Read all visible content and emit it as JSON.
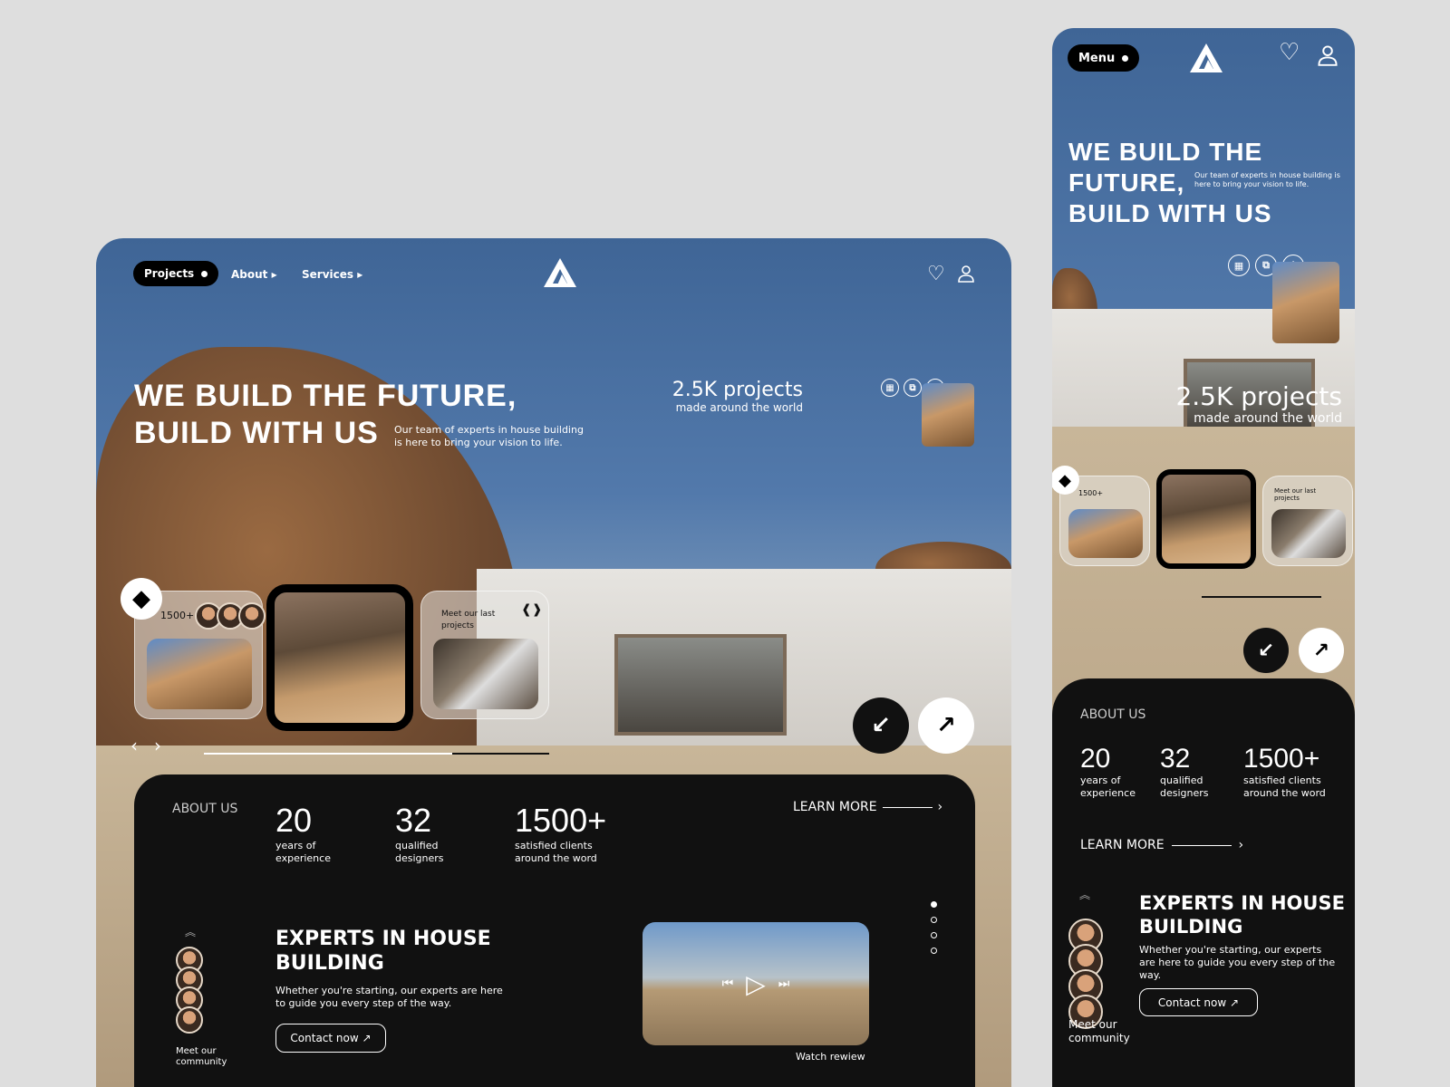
{
  "desktop": {
    "nav": {
      "projects": "Projects",
      "about": "About ▸",
      "services": "Services ▸"
    },
    "hero": {
      "line1": "WE BUILD THE FUTURE,",
      "line2": "BUILD WITH US",
      "desc1": "Our team of experts in house building",
      "desc2": "is here to bring your vision to life."
    },
    "stat": {
      "value": "2.5K projects",
      "label": "made around the world"
    },
    "cards": {
      "count": "1500+",
      "meet1": "Meet our last",
      "meet2": "projects"
    },
    "about": {
      "title": "ABOUT US",
      "learn": "LEARN MORE",
      "stats": [
        {
          "v": "20",
          "l1": "years of",
          "l2": "experience"
        },
        {
          "v": "32",
          "l1": "qualified",
          "l2": "designers"
        },
        {
          "v": "1500+",
          "l1": "satisfied clients",
          "l2": "around the word"
        }
      ]
    },
    "experts": {
      "t1": "EXPERTS IN HOUSE",
      "t2": "BUILDING",
      "d1": "Whether you're starting, our experts are here",
      "d2": "to guide you every step of the way.",
      "contact": "Contact now ↗",
      "watch": "Watch rewiew",
      "community1": "Meet our",
      "community2": "community"
    },
    "progress": 0.6
  },
  "mobile": {
    "menu": "Menu",
    "hero": {
      "l1": "WE BUILD THE",
      "l2": "FUTURE,",
      "l3": "BUILD WITH US",
      "desc": "Our team of experts in house building is here to bring your vision to life."
    },
    "stat": {
      "value": "2.5K projects",
      "label": "made around the world"
    },
    "cards": {
      "count": "1500+",
      "meet": "Meet our last projects"
    },
    "about": {
      "title": "ABOUT US",
      "learn": "LEARN MORE",
      "stats": [
        {
          "v": "20",
          "l1": "years of",
          "l2": "experience"
        },
        {
          "v": "32",
          "l1": "qualified",
          "l2": "designers"
        },
        {
          "v": "1500+",
          "l1": "satisfied clients",
          "l2": "around the word"
        }
      ]
    },
    "experts": {
      "t1": "EXPERTS IN HOUSE",
      "t2": "BUILDING",
      "desc": "Whether you're starting, our experts are here to guide you every step of the way.",
      "contact": "Contact now ↗",
      "community1": "Meet our",
      "community2": "community"
    }
  }
}
